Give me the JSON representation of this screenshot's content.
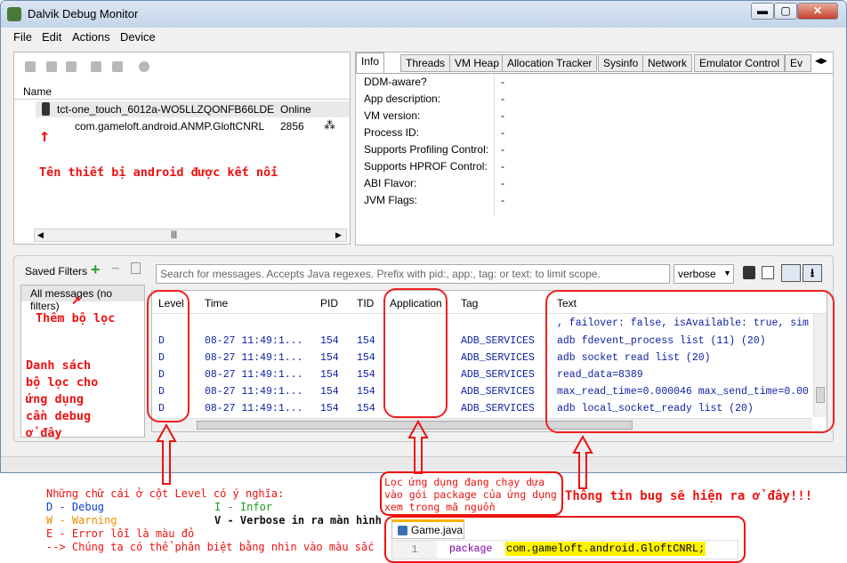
{
  "window": {
    "title": "Dalvik Debug Monitor",
    "minimize": "▬",
    "maximize": "▢",
    "close": "✕"
  },
  "menu": [
    "File",
    "Edit",
    "Actions",
    "Device"
  ],
  "devices": {
    "header": "Name",
    "device": {
      "name": "tct-one_touch_6012a-WO5LLZQONFB66LDE",
      "status": "Online"
    },
    "process": {
      "name": "com.gameloft.android.ANMP.GloftCNRL",
      "pid": "2856"
    }
  },
  "info_tabs": [
    "Info",
    "Threads",
    "VM Heap",
    "Allocation Tracker",
    "Sysinfo",
    "Network",
    "Emulator Control",
    "Ev"
  ],
  "info_rows": [
    {
      "label": "DDM-aware?",
      "value": "-"
    },
    {
      "label": "App description:",
      "value": "-"
    },
    {
      "label": "VM version:",
      "value": "-"
    },
    {
      "label": "Process ID:",
      "value": "-"
    },
    {
      "label": "Supports Profiling Control:",
      "value": "-"
    },
    {
      "label": "Supports HPROF Control:",
      "value": "-"
    },
    {
      "label": "ABI Flavor:",
      "value": "-"
    },
    {
      "label": "JVM Flags:",
      "value": "-"
    }
  ],
  "logcat": {
    "saved_filters": "Saved Filters",
    "all_messages": "All messages (no filters)",
    "search_placeholder": "Search for messages. Accepts Java regexes. Prefix with pid:, app:, tag: or text: to limit scope.",
    "level_select": "verbose",
    "columns": [
      "Level",
      "Time",
      "PID",
      "TID",
      "Application",
      "Tag",
      "Text"
    ],
    "first_text": ", failover: false, isAvailable: true, sim",
    "rows": [
      {
        "level": "D",
        "time": "08-27 11:49:1...",
        "pid": "154",
        "tid": "154",
        "app": "",
        "tag": "ADB_SERVICES",
        "text": "adb fdevent_process list (11) (20)"
      },
      {
        "level": "D",
        "time": "08-27 11:49:1...",
        "pid": "154",
        "tid": "154",
        "app": "",
        "tag": "ADB_SERVICES",
        "text": "adb socket read list (20)"
      },
      {
        "level": "D",
        "time": "08-27 11:49:1...",
        "pid": "154",
        "tid": "154",
        "app": "",
        "tag": "ADB_SERVICES",
        "text": "read_data=8389"
      },
      {
        "level": "D",
        "time": "08-27 11:49:1...",
        "pid": "154",
        "tid": "154",
        "app": "",
        "tag": "ADB_SERVICES",
        "text": "max_read_time=0.000046 max_send_time=0.00"
      },
      {
        "level": "D",
        "time": "08-27 11:49:1...",
        "pid": "154",
        "tid": "154",
        "app": "",
        "tag": "ADB_SERVICES",
        "text": "adb local_socket_ready list (20)"
      }
    ]
  },
  "annotations": {
    "device_note": "Tên thiết bị android được kết nối",
    "filter_note": "Thêm bộ lọc",
    "filter_list_note": [
      "Danh sách",
      "bộ lọc cho",
      "ứng dụng",
      "cần debug",
      "ở đây"
    ],
    "level_title": "Những chữ cái ở cột Level có ý nghĩa:",
    "level_d": "D - Debug",
    "level_i": "I - Infor",
    "level_w": "W - Warning",
    "level_v": "V - Verbose in ra màn hình",
    "level_e": "E - Error lỗi là màu đỏ",
    "level_note": "--> Chúng ta có thể phân biệt bằng nhìn vào màu sắc",
    "app_note": [
      "Lọc ứng dụng đang chạy dựa",
      "vào gói package của ứng dụng",
      "xem trong mã nguồn"
    ],
    "bug_note": "Thông tin bug sẽ hiện ra ở đây!!!",
    "code_tab": "Game.java",
    "code_line_no": "1",
    "code_keyword": "package",
    "code_pkg": "com.gameloft.android.GloftCNRL;"
  }
}
